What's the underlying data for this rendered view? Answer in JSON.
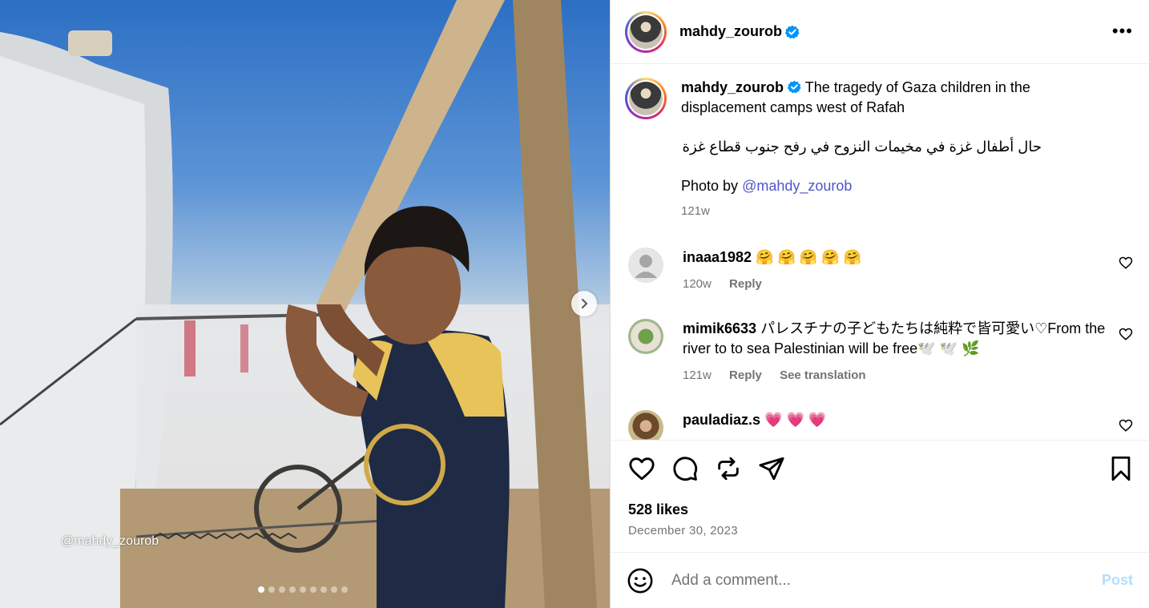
{
  "post": {
    "watermark": "@mahdy_zourob",
    "carousel": {
      "count": 9,
      "active_index": 0
    }
  },
  "header": {
    "username": "mahdy_zourob",
    "more_label": "•••"
  },
  "caption": {
    "username": "mahdy_zourob",
    "text": "The tragedy of Gaza children in the displacement camps west of Rafah",
    "arabic": "حال أطفال غزة في مخيمات النزوح في رفح جنوب قطاع غزة",
    "photo_by_prefix": "Photo by ",
    "photo_by_mention": "@mahdy_zourob",
    "time": "121w"
  },
  "comments": [
    {
      "username": "inaaa1982",
      "text": "🤗 🤗 🤗 🤗 🤗",
      "time": "120w",
      "reply": "Reply",
      "translation": ""
    },
    {
      "username": "mimik6633",
      "text": "パレスチナの子どもたちは純粋で皆可愛い♡From the river to to sea Palestinian will be free🕊️ 🕊️ 🌿",
      "time": "121w",
      "reply": "Reply",
      "translation": "See translation"
    },
    {
      "username": "pauladiaz.s",
      "text": "💗 💗 💗",
      "time": "",
      "reply": "",
      "translation": ""
    }
  ],
  "actions": {
    "likes": "528 likes",
    "date": "December 30, 2023"
  },
  "composer": {
    "placeholder": "Add a comment...",
    "post_label": "Post"
  },
  "colors": {
    "verified": "#0095f6",
    "mention": "#4b57c9",
    "post_disabled": "#b2dffc",
    "secondary_text": "#737373"
  }
}
